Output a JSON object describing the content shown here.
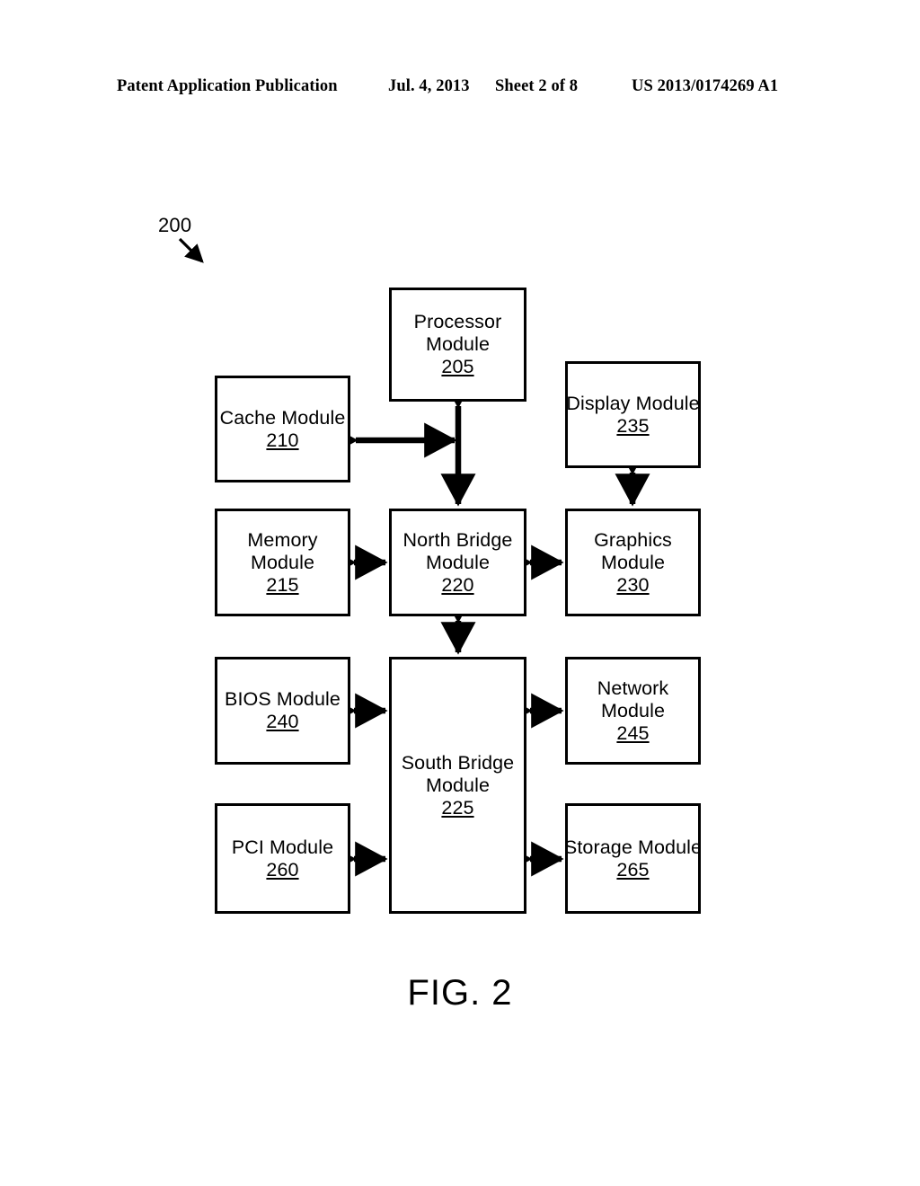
{
  "page": {
    "header": {
      "publication": "Patent Application Publication",
      "date": "Jul. 4, 2013",
      "sheet": "Sheet 2 of 8",
      "patent_number": "US 2013/0174269 A1"
    },
    "figure_caption": "FIG. 2",
    "diagram_reference_label": "200"
  },
  "diagram": {
    "title": "FIG. 2",
    "system_reference": "200",
    "colors": {
      "stroke": "#000000",
      "fill": "#ffffff",
      "text": "#000000"
    },
    "modules": [
      {
        "id": "processor",
        "line1": "Processor",
        "line2": "Module",
        "ref": "205"
      },
      {
        "id": "cache",
        "line1": "Cache Module",
        "line2": "",
        "ref": "210"
      },
      {
        "id": "display",
        "line1": "Display Module",
        "line2": "",
        "ref": "235"
      },
      {
        "id": "memory",
        "line1": "Memory",
        "line2": "Module",
        "ref": "215"
      },
      {
        "id": "north-bridge",
        "line1": "North Bridge",
        "line2": "Module",
        "ref": "220"
      },
      {
        "id": "graphics",
        "line1": "Graphics",
        "line2": "Module",
        "ref": "230"
      },
      {
        "id": "bios",
        "line1": "BIOS Module",
        "line2": "",
        "ref": "240"
      },
      {
        "id": "south-bridge",
        "line1": "South Bridge",
        "line2": "Module",
        "ref": "225"
      },
      {
        "id": "network",
        "line1": "Network",
        "line2": "Module",
        "ref": "245"
      },
      {
        "id": "pci",
        "line1": "PCI Module",
        "line2": "",
        "ref": "260"
      },
      {
        "id": "storage",
        "line1": "Storage Module",
        "line2": "",
        "ref": "265"
      }
    ],
    "connections": [
      {
        "from": "processor",
        "to": "north-bridge",
        "style": "double-arrow",
        "orientation": "vertical"
      },
      {
        "from": "cache",
        "to": "processor-north-bridge-bus",
        "style": "double-arrow",
        "orientation": "horizontal"
      },
      {
        "from": "memory",
        "to": "north-bridge",
        "style": "double-arrow",
        "orientation": "horizontal"
      },
      {
        "from": "north-bridge",
        "to": "graphics",
        "style": "double-arrow",
        "orientation": "horizontal"
      },
      {
        "from": "display",
        "to": "graphics",
        "style": "double-arrow",
        "orientation": "vertical"
      },
      {
        "from": "north-bridge",
        "to": "south-bridge",
        "style": "double-arrow",
        "orientation": "vertical"
      },
      {
        "from": "bios",
        "to": "south-bridge",
        "style": "double-arrow",
        "orientation": "horizontal"
      },
      {
        "from": "south-bridge",
        "to": "network",
        "style": "double-arrow",
        "orientation": "horizontal"
      },
      {
        "from": "pci",
        "to": "south-bridge",
        "style": "double-arrow",
        "orientation": "horizontal"
      },
      {
        "from": "south-bridge",
        "to": "storage",
        "style": "double-arrow",
        "orientation": "horizontal"
      }
    ]
  }
}
